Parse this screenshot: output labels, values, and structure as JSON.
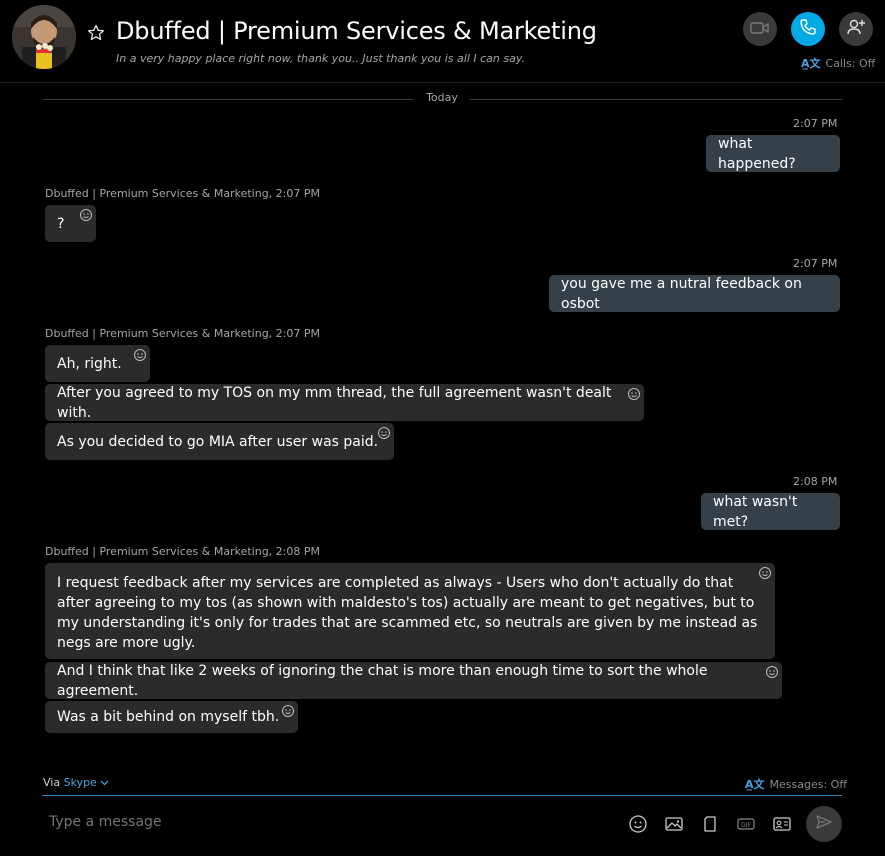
{
  "header": {
    "title": "Dbuffed | Premium Services & Marketing",
    "mood": "In a very happy place right now, thank you.. Just thank you is all I can say.",
    "calls_status": "Calls: Off",
    "translator_glyph": "A̲文"
  },
  "divider_label": "Today",
  "conversation": {
    "m1": {
      "time": "2:07 PM",
      "text": "what happened?"
    },
    "m2": {
      "sender": "Dbuffed | Premium Services & Marketing,",
      "time": "2:07 PM",
      "text": "?"
    },
    "m3": {
      "time": "2:07 PM",
      "text": "you gave me a nutral feedback on osbot"
    },
    "m4": {
      "sender": "Dbuffed | Premium Services & Marketing,",
      "time": "2:07 PM",
      "lines": [
        "Ah, right.",
        "After you agreed to my TOS on my mm thread, the full agreement wasn't dealt with.",
        "As you decided to go MIA after user was paid."
      ]
    },
    "m5": {
      "time": "2:08 PM",
      "text": "what wasn't met?"
    },
    "m6": {
      "sender": "Dbuffed | Premium Services & Marketing,",
      "time": "2:08 PM",
      "lines": [
        "I request feedback after my services are completed as always - Users who don't actually do that after agreeing to my tos (as shown with maldesto's tos) actually are meant to get negatives, but to my understanding it's only for trades that are scammed etc, so neutrals are given by me instead as negs are more ugly.",
        "And I think that like 2 weeks of ignoring the chat is more than enough time to sort the whole agreement.",
        "Was a bit behind on myself tbh."
      ]
    }
  },
  "footer": {
    "via_label": "Via",
    "via_link": "Skype",
    "messages_status": "Messages: Off",
    "compose_placeholder": "Type a message"
  },
  "colors": {
    "background": "#000000",
    "accent": "#00a8e6",
    "outgoing_bubble": "#354048",
    "incoming_bubble": "#2b2b2b",
    "muted_text": "#a6a6a6"
  },
  "icons": [
    "avatar",
    "star-icon",
    "video-call-icon",
    "phone-icon",
    "add-person-icon",
    "translator-icon",
    "reaction-icon",
    "emoji-icon",
    "image-icon",
    "file-icon",
    "gif-icon",
    "contact-card-icon",
    "send-icon",
    "chevron-down-icon"
  ]
}
